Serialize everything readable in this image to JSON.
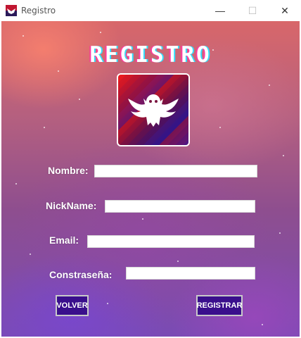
{
  "window": {
    "title": "Registro",
    "controls": {
      "minimize": "—",
      "maximize": "☐",
      "close": "✕"
    }
  },
  "heading": "REGISTRO",
  "logo": {
    "icon": "owl-icon",
    "colors": [
      "#d51820",
      "#551262",
      "#3a1bb0"
    ]
  },
  "form": {
    "nombre_label": "Nombre:",
    "nombre_value": "",
    "nickname_label": "NickName:",
    "nickname_value": "",
    "email_label": "Email:",
    "email_value": "",
    "password_label": "Constraseña:",
    "password_value": ""
  },
  "buttons": {
    "volver": "VOLVER",
    "registrar": "REGISTRAR"
  },
  "colors": {
    "button_bg": "#3a0f8c",
    "heading_glow_left": "#ff3ba0",
    "heading_glow_right": "#33e0ff"
  }
}
